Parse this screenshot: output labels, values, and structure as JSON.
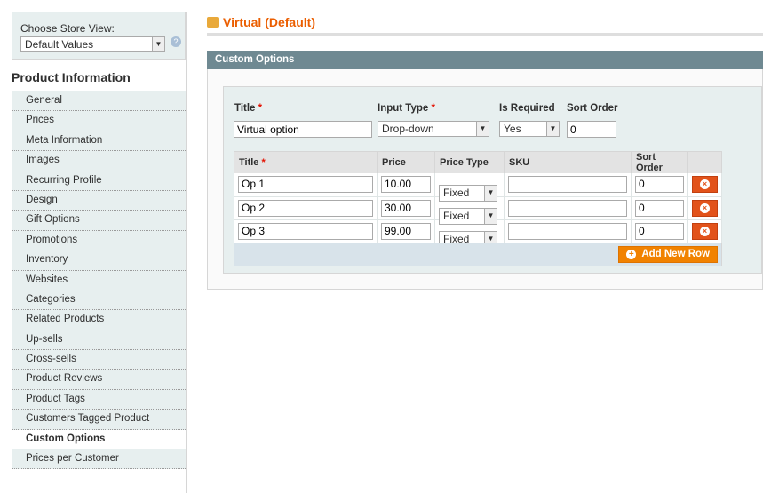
{
  "store_switcher": {
    "label": "Choose Store View:",
    "selected": "Default Values",
    "help_icon": "help-icon"
  },
  "sidebar": {
    "heading": "Product Information",
    "items": [
      {
        "label": "General"
      },
      {
        "label": "Prices"
      },
      {
        "label": "Meta Information"
      },
      {
        "label": "Images"
      },
      {
        "label": "Recurring Profile"
      },
      {
        "label": "Design"
      },
      {
        "label": "Gift Options"
      },
      {
        "label": "Promotions"
      },
      {
        "label": "Inventory"
      },
      {
        "label": "Websites"
      },
      {
        "label": "Categories"
      },
      {
        "label": "Related Products"
      },
      {
        "label": "Up-sells"
      },
      {
        "label": "Cross-sells"
      },
      {
        "label": "Product Reviews"
      },
      {
        "label": "Product Tags"
      },
      {
        "label": "Customers Tagged Product"
      },
      {
        "label": "Custom Options",
        "active": true
      },
      {
        "label": "Prices per Customer"
      }
    ]
  },
  "page": {
    "title": "Virtual (Default)",
    "section_title": "Custom Options"
  },
  "option": {
    "title_label": "Title",
    "input_type_label": "Input Type",
    "is_required_label": "Is Required",
    "sort_order_label": "Sort Order",
    "required_mark": "*",
    "title": "Virtual option",
    "input_type": "Drop-down",
    "is_required": "Yes",
    "sort_order": "0"
  },
  "rows_table": {
    "headers": {
      "title": "Title",
      "price": "Price",
      "price_type": "Price Type",
      "sku": "SKU",
      "sort_order": "Sort Order"
    },
    "rows": [
      {
        "title": "Op 1",
        "price": "10.00",
        "price_type": "Fixed",
        "sku": "",
        "sort_order": "0"
      },
      {
        "title": "Op 2",
        "price": "30.00",
        "price_type": "Fixed",
        "sku": "",
        "sort_order": "0"
      },
      {
        "title": "Op 3",
        "price": "99.00",
        "price_type": "Fixed",
        "sku": "",
        "sort_order": "0"
      }
    ],
    "add_label": "Add New Row"
  },
  "colors": {
    "accent": "#eb5e00",
    "section_header": "#6f8992",
    "button": "#f18200",
    "delete": "#e2531b"
  }
}
